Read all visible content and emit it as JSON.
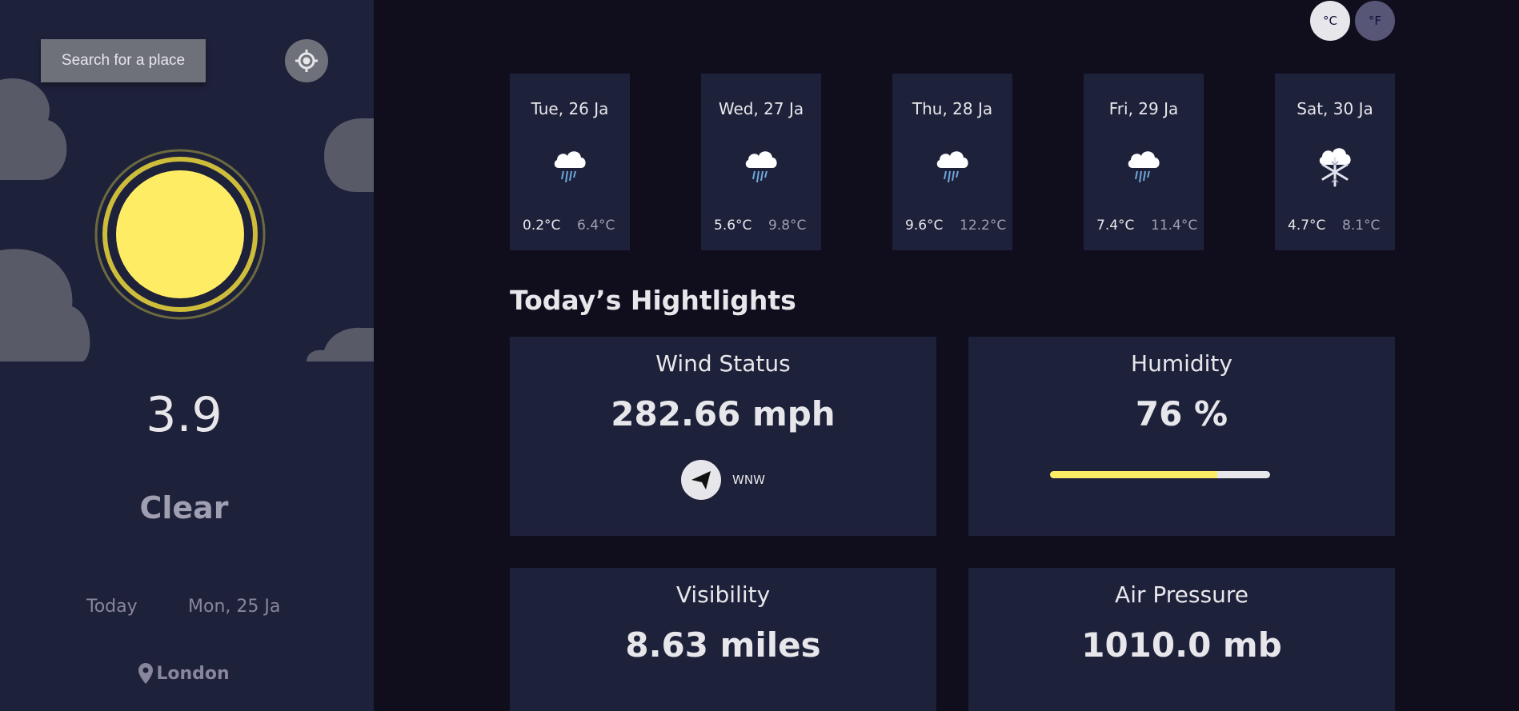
{
  "search": {
    "label": "Search for a place"
  },
  "current": {
    "temp": "3.9",
    "condition": "Clear",
    "today_label": "Today",
    "date": "Mon, 25 Ja",
    "location": "London"
  },
  "units": {
    "celsius": "°C",
    "fahrenheit": "°F"
  },
  "forecast": [
    {
      "day": "Tue, 26 Ja",
      "min": "0.2°C",
      "max": "6.4°C",
      "icon": "rain-cloud-icon"
    },
    {
      "day": "Wed, 27 Ja",
      "min": "5.6°C",
      "max": "9.8°C",
      "icon": "rain-cloud-icon"
    },
    {
      "day": "Thu, 28 Ja",
      "min": "9.6°C",
      "max": "12.2°C",
      "icon": "rain-cloud-icon"
    },
    {
      "day": "Fri, 29 Ja",
      "min": "7.4°C",
      "max": "11.4°C",
      "icon": "rain-cloud-icon"
    },
    {
      "day": "Sat, 30 Ja",
      "min": "4.7°C",
      "max": "8.1°C",
      "icon": "snow-cloud-icon"
    }
  ],
  "highlights": {
    "title": "Today’s Hightlights",
    "wind": {
      "title": "Wind Status",
      "value": "282.66 mph",
      "direction": "WNW"
    },
    "humidity": {
      "title": "Humidity",
      "value": "76 %",
      "percent": 76
    },
    "visibility": {
      "title": "Visibility",
      "value": "8.63 miles"
    },
    "pressure": {
      "title": "Air Pressure",
      "value": "1010.0 mb"
    }
  },
  "colors": {
    "sidebar_bg": "#1e213a",
    "main_bg": "#100e1d",
    "accent_yellow": "#ffec65",
    "text_primary": "#e7e7eb",
    "text_secondary": "#a09fb1"
  }
}
